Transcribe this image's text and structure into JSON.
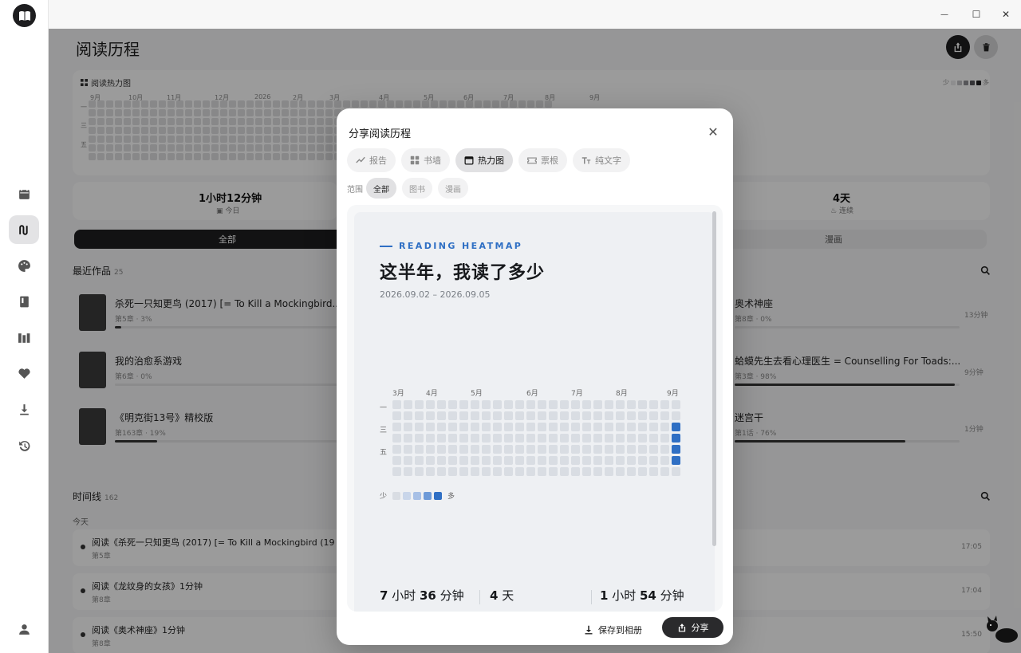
{
  "window": {
    "minimize": "—",
    "maximize": "☐",
    "close": "✕"
  },
  "page": {
    "title": "阅读历程",
    "heatmap": {
      "title": "阅读热力图",
      "months": [
        "9月",
        "10月",
        "11月",
        "12月",
        "2026",
        "2月",
        "3月",
        "4月",
        "5月",
        "6月",
        "7月",
        "8月",
        "9月"
      ],
      "weekdays": [
        "一",
        "三",
        "五"
      ],
      "legend_less": "少",
      "legend_more": "多"
    },
    "stats": [
      {
        "value": "1小时12分钟",
        "label": "今日"
      },
      {
        "value": "4天",
        "label": "连续"
      }
    ],
    "tabs": [
      "全部",
      "漫画"
    ],
    "recent": {
      "title": "最近作品",
      "count": "25",
      "books": [
        {
          "title": "杀死一只知更鸟 (2017) [= To Kill a Mockingbird...",
          "sub": "第5章 · 3%",
          "progress": 0.03
        },
        {
          "title": "我的治愈系游戏",
          "sub": "第6章 · 0%",
          "progress": 0.0
        },
        {
          "title": "《明克街13号》精校版",
          "sub": "第163章 · 19%",
          "progress": 0.19
        },
        {
          "title": "奥术神座",
          "sub": "第8章 · 0%",
          "progress": 0.0,
          "time": "13分钟"
        },
        {
          "title": "蛤蟆先生去看心理医生 = Counselling For Toads:...",
          "sub": "第3章 · 98%",
          "progress": 0.98,
          "time": "9分钟"
        },
        {
          "title": "迷宫干",
          "sub": "第1话 · 76%",
          "progress": 0.76,
          "time": "1分钟"
        }
      ]
    },
    "timeline": {
      "title": "时间线",
      "count": "162",
      "group": "今天",
      "items": [
        {
          "title": "阅读《杀死一只知更鸟 (2017) [= To Kill a Mockingbird (19",
          "sub": "第5章",
          "time": "17:05"
        },
        {
          "title": "阅读《龙纹身的女孩》1分钟",
          "sub": "第8章",
          "time": "17:04"
        },
        {
          "title": "阅读《奥术神座》1分钟",
          "sub": "第8章",
          "time": "15:50"
        }
      ]
    }
  },
  "modal": {
    "title": "分享阅读历程",
    "close": "✕",
    "mode_tabs": [
      {
        "label": "报告",
        "icon": "trend-icon"
      },
      {
        "label": "书墙",
        "icon": "grid-icon"
      },
      {
        "label": "热力图",
        "icon": "calendar-icon",
        "active": true
      },
      {
        "label": "票根",
        "icon": "ticket-icon"
      },
      {
        "label": "纯文字",
        "icon": "text-icon"
      }
    ],
    "range_label": "范围",
    "range_chips": [
      {
        "label": "全部",
        "active": true
      },
      {
        "label": "图书"
      },
      {
        "label": "漫画"
      }
    ],
    "poster": {
      "kicker": "READING HEATMAP",
      "title": "这半年，我读了多少",
      "date_range": "2026.09.02 – 2026.09.05",
      "months": [
        "3月",
        "4月",
        "5月",
        "6月",
        "7月",
        "8月",
        "9月"
      ],
      "weekdays": [
        "一",
        "三",
        "五"
      ],
      "legend_less": "少",
      "legend_more": "多",
      "colors": {
        "empty": "#d9dde3",
        "l1": "#c9d6ea",
        "l2": "#a7c0e6",
        "l3": "#6d9ad8",
        "l4": "#2f6fc4"
      },
      "active_days": [
        {
          "week": 25,
          "day": 2,
          "level": 4
        },
        {
          "week": 25,
          "day": 3,
          "level": 4
        },
        {
          "week": 25,
          "day": 4,
          "level": 4
        },
        {
          "week": 25,
          "day": 5,
          "level": 4
        }
      ],
      "stats": [
        {
          "num1": "7",
          "unit1": " 小时 ",
          "num2": "36",
          "unit2": " 分钟"
        },
        {
          "num1": "4",
          "unit1": " 天",
          "num2": "",
          "unit2": ""
        },
        {
          "num1": "1",
          "unit1": " 小时 ",
          "num2": "54",
          "unit2": " 分钟"
        }
      ]
    },
    "save_label": "保存到相册",
    "share_label": "分享"
  }
}
